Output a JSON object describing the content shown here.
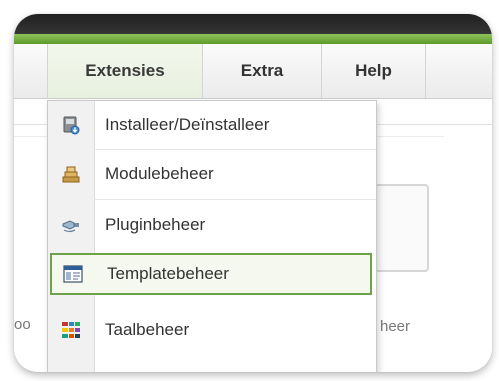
{
  "menubar": {
    "items": [
      {
        "label": "Extensies",
        "active": true
      },
      {
        "label": "Extra",
        "active": false
      },
      {
        "label": "Help",
        "active": false
      }
    ]
  },
  "dropdown": {
    "items": [
      {
        "label": "Installeer/Deïnstalleer",
        "icon": "installer-icon",
        "highlighted": false
      },
      {
        "label": "Modulebeheer",
        "icon": "module-icon",
        "highlighted": false
      },
      {
        "label": "Pluginbeheer",
        "icon": "plugin-icon",
        "highlighted": false
      },
      {
        "label": "Templatebeheer",
        "icon": "template-icon",
        "highlighted": true
      },
      {
        "label": "Taalbeheer",
        "icon": "language-icon",
        "highlighted": false
      }
    ]
  },
  "background": {
    "left_fragment": "oo",
    "right_fragment": "heer"
  },
  "colors": {
    "green_bar": "#6fa83b",
    "highlight_border": "#6ba24a",
    "menu_active": "#eef5e6"
  }
}
